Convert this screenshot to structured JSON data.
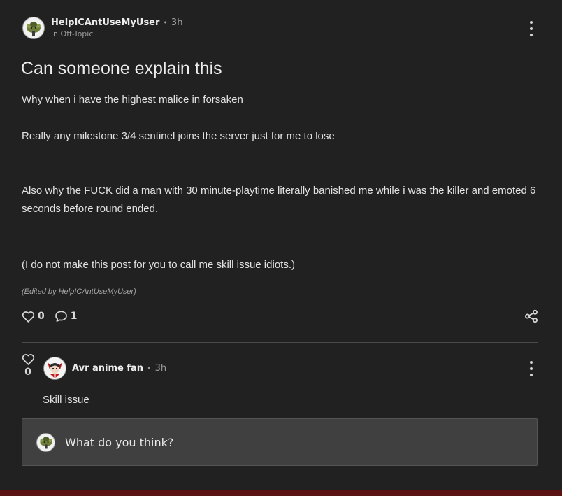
{
  "post": {
    "author": "HelpICAntUseMyUser",
    "time": "3h",
    "community": "in Off-Topic",
    "title": "Can someone explain this",
    "paragraphs": [
      "Why when i have the highest malice in forsaken",
      "Really any milestone 3/4 sentinel joins the server just for me to lose",
      "Also why the FUCK did a man with 30 minute-playtime literally banished me while i was the killer and emoted 6 seconds before round ended.",
      "(I do not make this post for you to call me skill issue idiots.)"
    ],
    "edited_note": "(Edited by HelpICAntUseMyUser)",
    "like_count": "0",
    "comment_count": "1",
    "icons": {
      "avatar": "goblin-avatar-icon",
      "more": "kebab-menu-icon",
      "like": "heart-outline-icon",
      "comment": "speech-bubble-icon",
      "share": "share-nodes-icon"
    }
  },
  "comment": {
    "author": "Avr anime fan",
    "time": "3h",
    "body": "Skill issue",
    "like_count": "0",
    "icons": {
      "avatar": "anime-character-avatar-icon",
      "like": "heart-outline-icon",
      "more": "kebab-menu-icon"
    }
  },
  "reply": {
    "placeholder": "What do you think?"
  },
  "colors": {
    "background": "#212121",
    "reply_box": "#404040",
    "accent_strip": "#5a1212"
  }
}
